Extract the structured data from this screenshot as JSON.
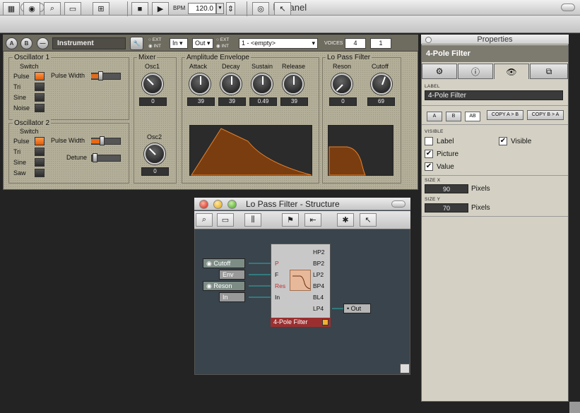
{
  "window": {
    "title": "Panel"
  },
  "toolbar": {
    "bpm_label": "BPM",
    "bpm_value": "120.0"
  },
  "instrument": {
    "btn_a": "A",
    "btn_b": "B",
    "name": "Instrument",
    "ext_label": "EXT",
    "int_label": "INT",
    "in_select": "In",
    "out_select": "Out",
    "preset": "1 - <empty>",
    "voices_label": "VOICES",
    "voices": "4",
    "voice_value": "1"
  },
  "osc1": {
    "title": "Oscillator 1",
    "switch_label": "Switch",
    "items": [
      "Pulse",
      "Tri",
      "Sine",
      "Noise"
    ],
    "selected": 0,
    "pw_label": "Pulse Width"
  },
  "osc2": {
    "title": "Oscillator 2",
    "switch_label": "Switch",
    "items": [
      "Pulse",
      "Tri",
      "Sine",
      "Saw"
    ],
    "selected": 0,
    "pw_label": "Pulse Width",
    "detune_label": "Detune"
  },
  "mixer": {
    "title": "Mixer",
    "osc1_label": "Osc1",
    "osc1_value": "0",
    "osc2_label": "Osc2",
    "osc2_value": "0"
  },
  "amp_env": {
    "title": "Amplitude Envelope",
    "knobs": [
      {
        "label": "Attack",
        "value": "39"
      },
      {
        "label": "Decay",
        "value": "39"
      },
      {
        "label": "Sustain",
        "value": "0.49"
      },
      {
        "label": "Release",
        "value": "39"
      }
    ]
  },
  "lpf": {
    "title": "Lo Pass Filter",
    "knobs": [
      {
        "label": "Reson",
        "value": "0"
      },
      {
        "label": "Cutoff",
        "value": "69"
      }
    ]
  },
  "properties": {
    "title": "Properties",
    "name": "4-Pole Filter",
    "label_caption": "LABEL",
    "label_value": "4-Pole Filter",
    "copy_ab": "COPY A > B",
    "copy_ba": "COPY B > A",
    "state_a": "A",
    "state_b": "B",
    "state_ab": "AB",
    "visible_caption": "VISIBLE",
    "cb_label": "Label",
    "cb_visible": "Visible",
    "cb_picture": "Picture",
    "cb_value": "Value",
    "size_x_caption": "SIZE X",
    "size_x": "90",
    "size_y_caption": "SIZE Y",
    "size_y": "70",
    "pixels": "Pixels",
    "checked": {
      "label": false,
      "visible": true,
      "picture": true,
      "value": true
    }
  },
  "structure": {
    "title": "Lo Pass Filter - Structure",
    "inputs": [
      {
        "label": "Cutoff",
        "port": "P"
      },
      {
        "label": "Env",
        "port": "F"
      },
      {
        "label": "Reson",
        "port": "Res"
      },
      {
        "label": "In",
        "port": "In"
      }
    ],
    "outputs": [
      "HP2",
      "BP2",
      "LP2",
      "BP4",
      "BL4",
      "LP4"
    ],
    "filter_name": "4-Pole Filter",
    "out_module": "Out"
  }
}
